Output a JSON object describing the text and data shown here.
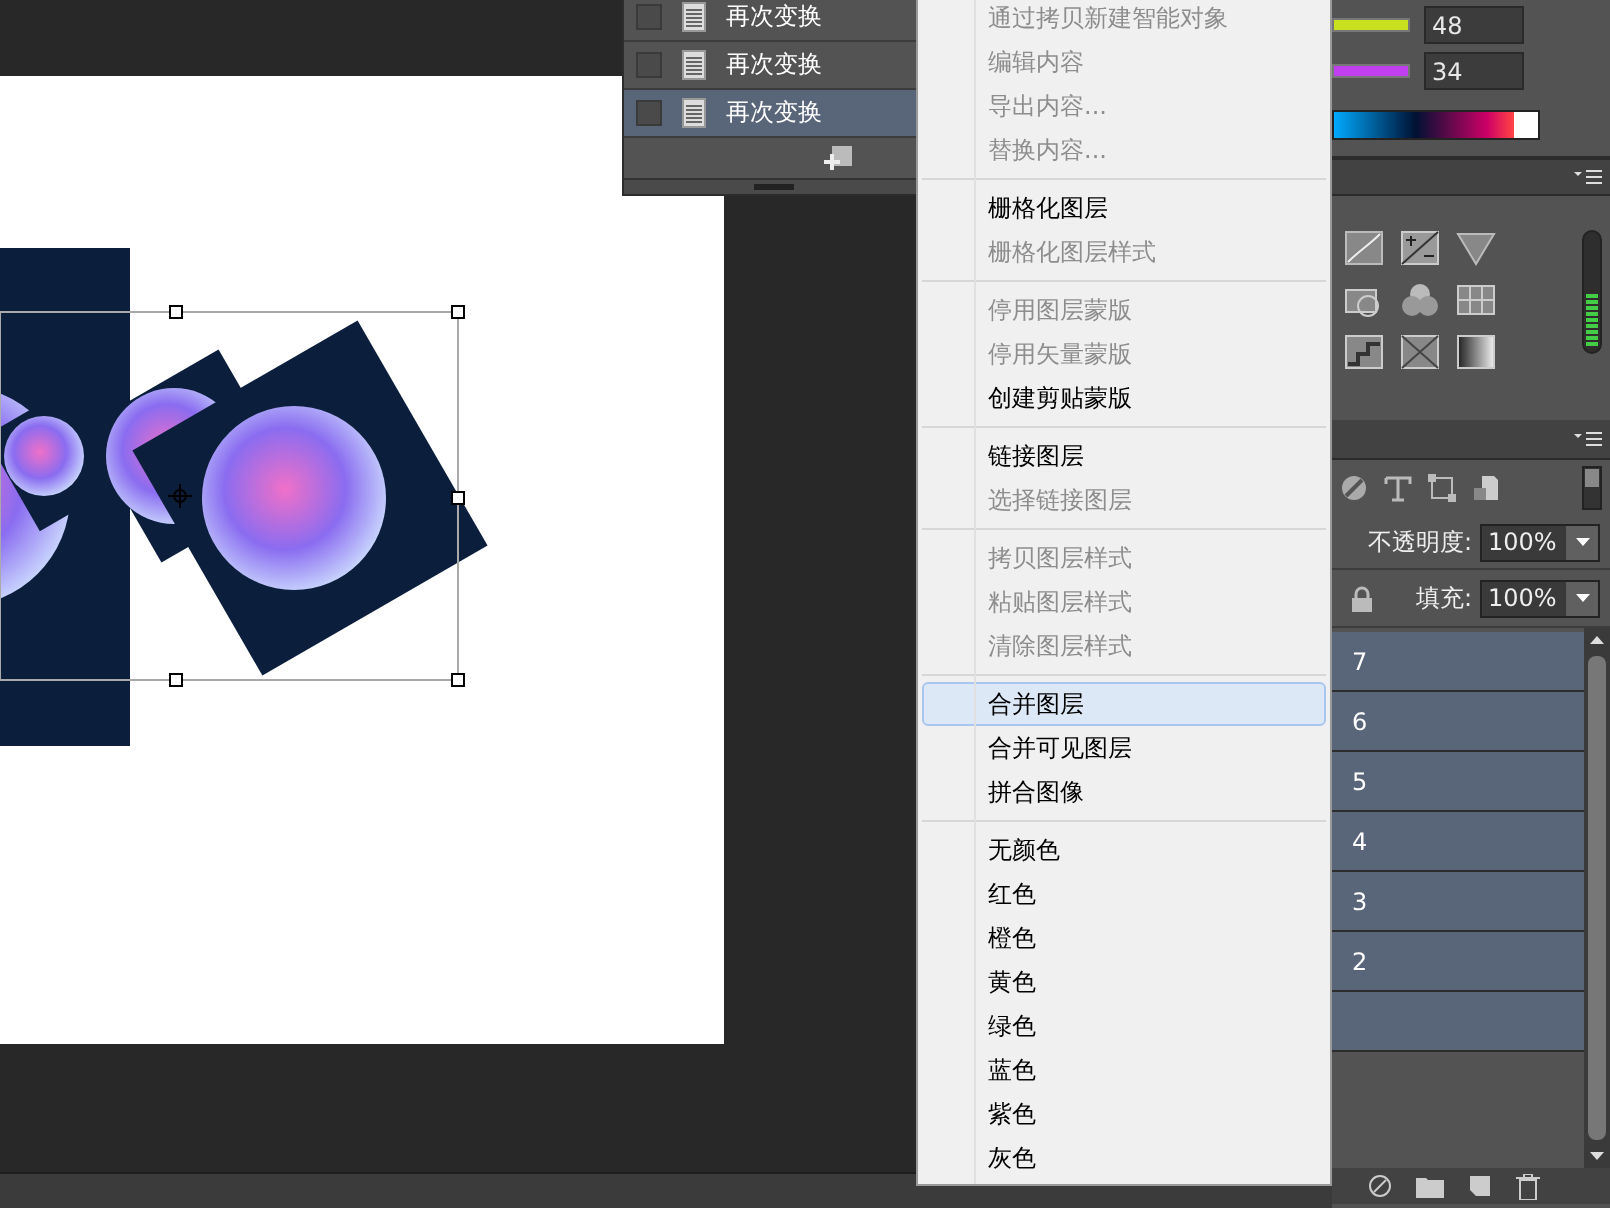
{
  "history": {
    "rows": [
      {
        "label": "再次变换",
        "selected": false
      },
      {
        "label": "再次变换",
        "selected": false
      },
      {
        "label": "再次变换",
        "selected": true
      }
    ]
  },
  "context_menu": {
    "sections": [
      {
        "items": [
          {
            "label": "通过拷贝新建智能对象",
            "disabled": true,
            "selected": false
          },
          {
            "label": "编辑内容",
            "disabled": true,
            "selected": false
          },
          {
            "label": "导出内容...",
            "disabled": true,
            "selected": false
          },
          {
            "label": "替换内容...",
            "disabled": true,
            "selected": false
          }
        ]
      },
      {
        "items": [
          {
            "label": "栅格化图层",
            "disabled": false,
            "selected": false
          },
          {
            "label": "栅格化图层样式",
            "disabled": true,
            "selected": false
          }
        ]
      },
      {
        "items": [
          {
            "label": "停用图层蒙版",
            "disabled": true,
            "selected": false
          },
          {
            "label": "停用矢量蒙版",
            "disabled": true,
            "selected": false
          },
          {
            "label": "创建剪贴蒙版",
            "disabled": false,
            "selected": false
          }
        ]
      },
      {
        "items": [
          {
            "label": "链接图层",
            "disabled": false,
            "selected": false
          },
          {
            "label": "选择链接图层",
            "disabled": true,
            "selected": false
          }
        ]
      },
      {
        "items": [
          {
            "label": "拷贝图层样式",
            "disabled": true,
            "selected": false
          },
          {
            "label": "粘贴图层样式",
            "disabled": true,
            "selected": false
          },
          {
            "label": "清除图层样式",
            "disabled": true,
            "selected": false
          }
        ]
      },
      {
        "items": [
          {
            "label": "合并图层",
            "disabled": false,
            "selected": true
          },
          {
            "label": "合并可见图层",
            "disabled": false,
            "selected": false
          },
          {
            "label": "拼合图像",
            "disabled": false,
            "selected": false
          }
        ]
      },
      {
        "items": [
          {
            "label": "无颜色",
            "disabled": false,
            "selected": false
          },
          {
            "label": "红色",
            "disabled": false,
            "selected": false
          },
          {
            "label": "橙色",
            "disabled": false,
            "selected": false
          },
          {
            "label": "黄色",
            "disabled": false,
            "selected": false
          },
          {
            "label": "绿色",
            "disabled": false,
            "selected": false
          },
          {
            "label": "蓝色",
            "disabled": false,
            "selected": false
          },
          {
            "label": "紫色",
            "disabled": false,
            "selected": false
          },
          {
            "label": "灰色",
            "disabled": false,
            "selected": false
          }
        ]
      }
    ]
  },
  "color_panel": {
    "sliders": [
      {
        "value": "48",
        "color": "#c8e020"
      },
      {
        "value": "34",
        "color": "#c040f0"
      }
    ]
  },
  "layers_panel": {
    "opacity": {
      "label": "不透明度:",
      "value": "100%"
    },
    "fill": {
      "label": "填充:",
      "value": "100%"
    },
    "layers": [
      {
        "name": "7",
        "selected": true
      },
      {
        "name": "6",
        "selected": true
      },
      {
        "name": "5",
        "selected": true
      },
      {
        "name": "4",
        "selected": true
      },
      {
        "name": "3",
        "selected": true
      },
      {
        "name": "2",
        "selected": true
      },
      {
        "selected": true
      }
    ]
  }
}
